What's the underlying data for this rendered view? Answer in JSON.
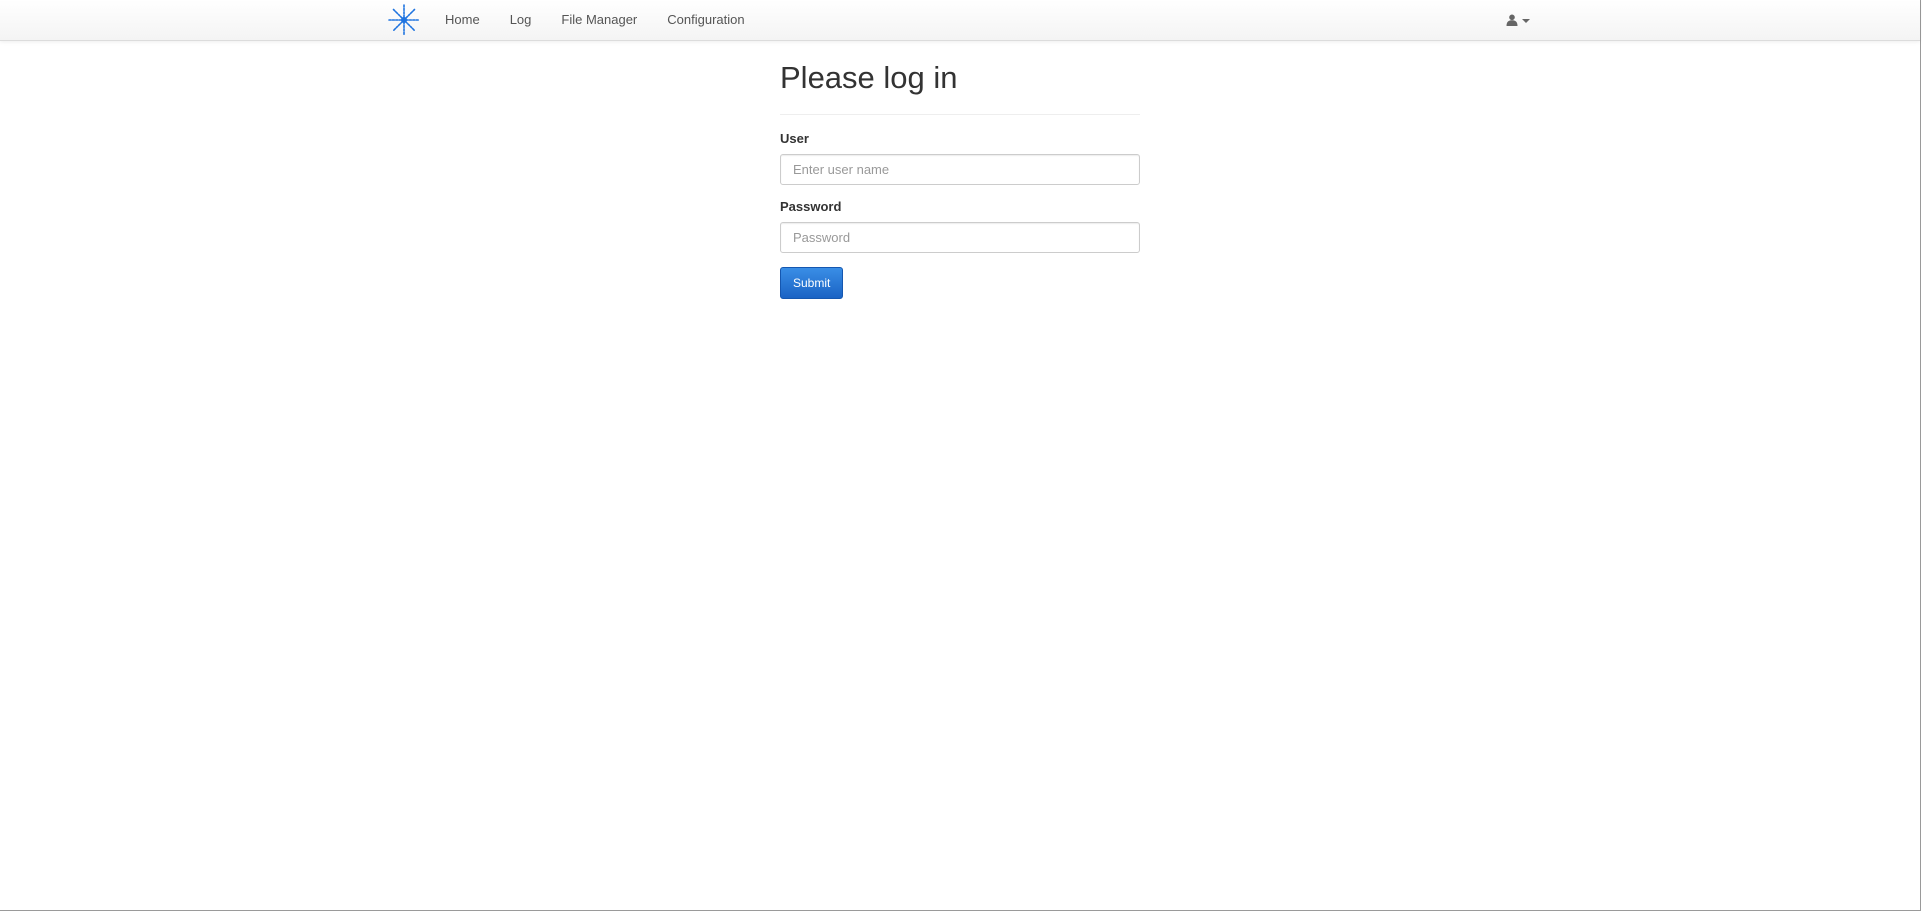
{
  "navbar": {
    "brand_icon": "starburst-logo-icon",
    "brand_color": "#1f74e0",
    "links": [
      {
        "label": "Home"
      },
      {
        "label": "Log"
      },
      {
        "label": "File Manager"
      },
      {
        "label": "Configuration"
      }
    ],
    "user_menu_icon": "user-icon"
  },
  "login": {
    "title": "Please log in",
    "user_label": "User",
    "user_placeholder": "Enter user name",
    "user_value": "",
    "password_label": "Password",
    "password_placeholder": "Password",
    "password_value": "",
    "submit_label": "Submit",
    "accent_color": "#1f6fd6"
  }
}
